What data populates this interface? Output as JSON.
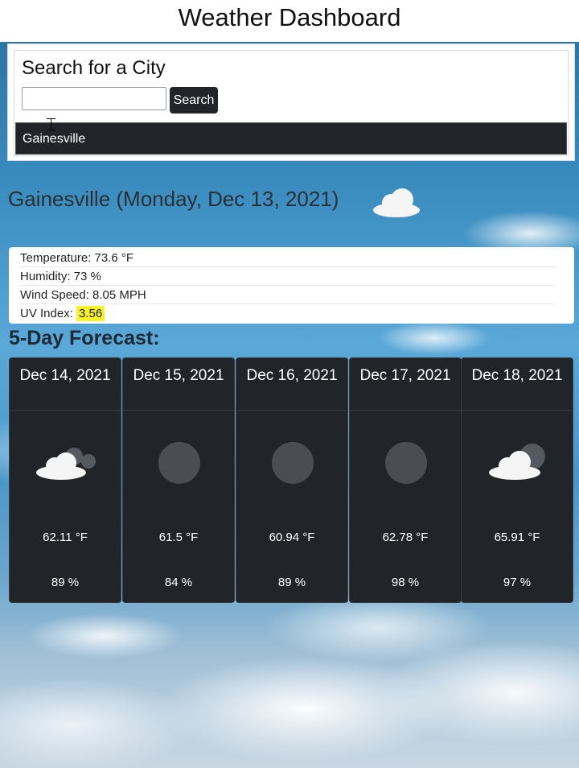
{
  "header": {
    "title": "Weather Dashboard"
  },
  "search": {
    "heading": "Search for a City",
    "input_value": "",
    "placeholder": "",
    "button_label": "Search",
    "history": [
      "Gainesville"
    ]
  },
  "current": {
    "title": "Gainesville (Monday, Dec 13, 2021)",
    "icon": "cloud-icon",
    "temperature": "Temperature: 73.6 °F",
    "humidity": "Humidity: 73 %",
    "wind": "Wind Speed: 8.05 MPH",
    "uv_label": "UV Index:",
    "uv_value": "3.56",
    "uv_color": "#f6f22a"
  },
  "forecast": {
    "title": "5-Day Forecast:",
    "days": [
      {
        "date": "Dec 14, 2021",
        "icon": "partly-cloudy-night-icon",
        "temp": "62.11 °F",
        "humidity": "89 %"
      },
      {
        "date": "Dec 15, 2021",
        "icon": "moon-icon",
        "temp": "61.5 °F",
        "humidity": "84 %"
      },
      {
        "date": "Dec 16, 2021",
        "icon": "moon-icon",
        "temp": "60.94 °F",
        "humidity": "89 %"
      },
      {
        "date": "Dec 17, 2021",
        "icon": "moon-icon",
        "temp": "62.78 °F",
        "humidity": "98 %"
      },
      {
        "date": "Dec 18, 2021",
        "icon": "cloud-moon-icon",
        "temp": "65.91 °F",
        "humidity": "97 %"
      }
    ]
  }
}
